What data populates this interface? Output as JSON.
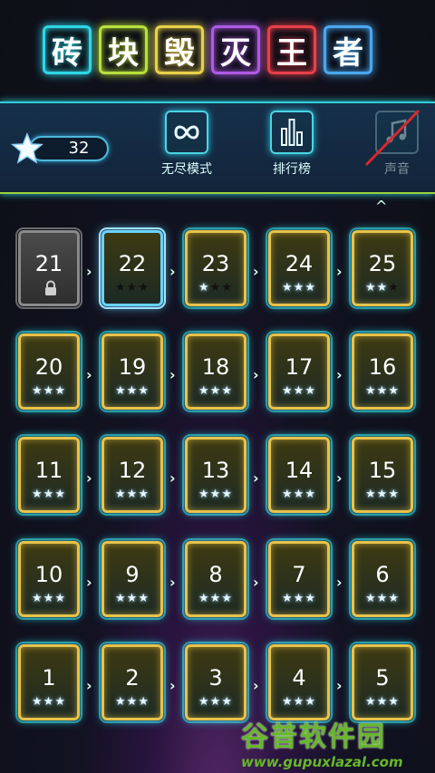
{
  "title": {
    "chars": [
      {
        "char": "砖",
        "color": "#2fd6e6"
      },
      {
        "char": "块",
        "color": "#b8e03a"
      },
      {
        "char": "毁",
        "color": "#e8d24a"
      },
      {
        "char": "灭",
        "color": "#b05ae6"
      },
      {
        "char": "王",
        "color": "#e8404a"
      },
      {
        "char": "者",
        "color": "#4aa8f0"
      }
    ]
  },
  "header": {
    "star_count": "32",
    "menu": [
      {
        "label": "无尽模式",
        "icon": "infinity-icon",
        "enabled": true
      },
      {
        "label": "排行榜",
        "icon": "bar-chart-icon",
        "enabled": true
      },
      {
        "label": "声音",
        "icon": "music-note-muted-icon",
        "enabled": false
      }
    ],
    "scroll_up": "^"
  },
  "levels": [
    [
      {
        "n": "21",
        "stars": 0,
        "locked": true
      },
      {
        "n": "22",
        "stars": 0,
        "current": true
      },
      {
        "n": "23",
        "stars": 1
      },
      {
        "n": "24",
        "stars": 3
      },
      {
        "n": "25",
        "stars": 2
      }
    ],
    [
      {
        "n": "20",
        "stars": 3
      },
      {
        "n": "19",
        "stars": 3
      },
      {
        "n": "18",
        "stars": 3
      },
      {
        "n": "17",
        "stars": 3
      },
      {
        "n": "16",
        "stars": 3
      }
    ],
    [
      {
        "n": "11",
        "stars": 3
      },
      {
        "n": "12",
        "stars": 3
      },
      {
        "n": "13",
        "stars": 3
      },
      {
        "n": "14",
        "stars": 3
      },
      {
        "n": "15",
        "stars": 3
      }
    ],
    [
      {
        "n": "10",
        "stars": 3
      },
      {
        "n": "9",
        "stars": 3
      },
      {
        "n": "8",
        "stars": 3
      },
      {
        "n": "7",
        "stars": 3
      },
      {
        "n": "6",
        "stars": 3
      }
    ],
    [
      {
        "n": "1",
        "stars": 3
      },
      {
        "n": "2",
        "stars": 3
      },
      {
        "n": "3",
        "stars": 3
      },
      {
        "n": "4",
        "stars": 3
      },
      {
        "n": "5",
        "stars": 3
      }
    ]
  ],
  "watermark": {
    "logo": "谷普软件园",
    "url": "www.gupuxlazal.com"
  }
}
